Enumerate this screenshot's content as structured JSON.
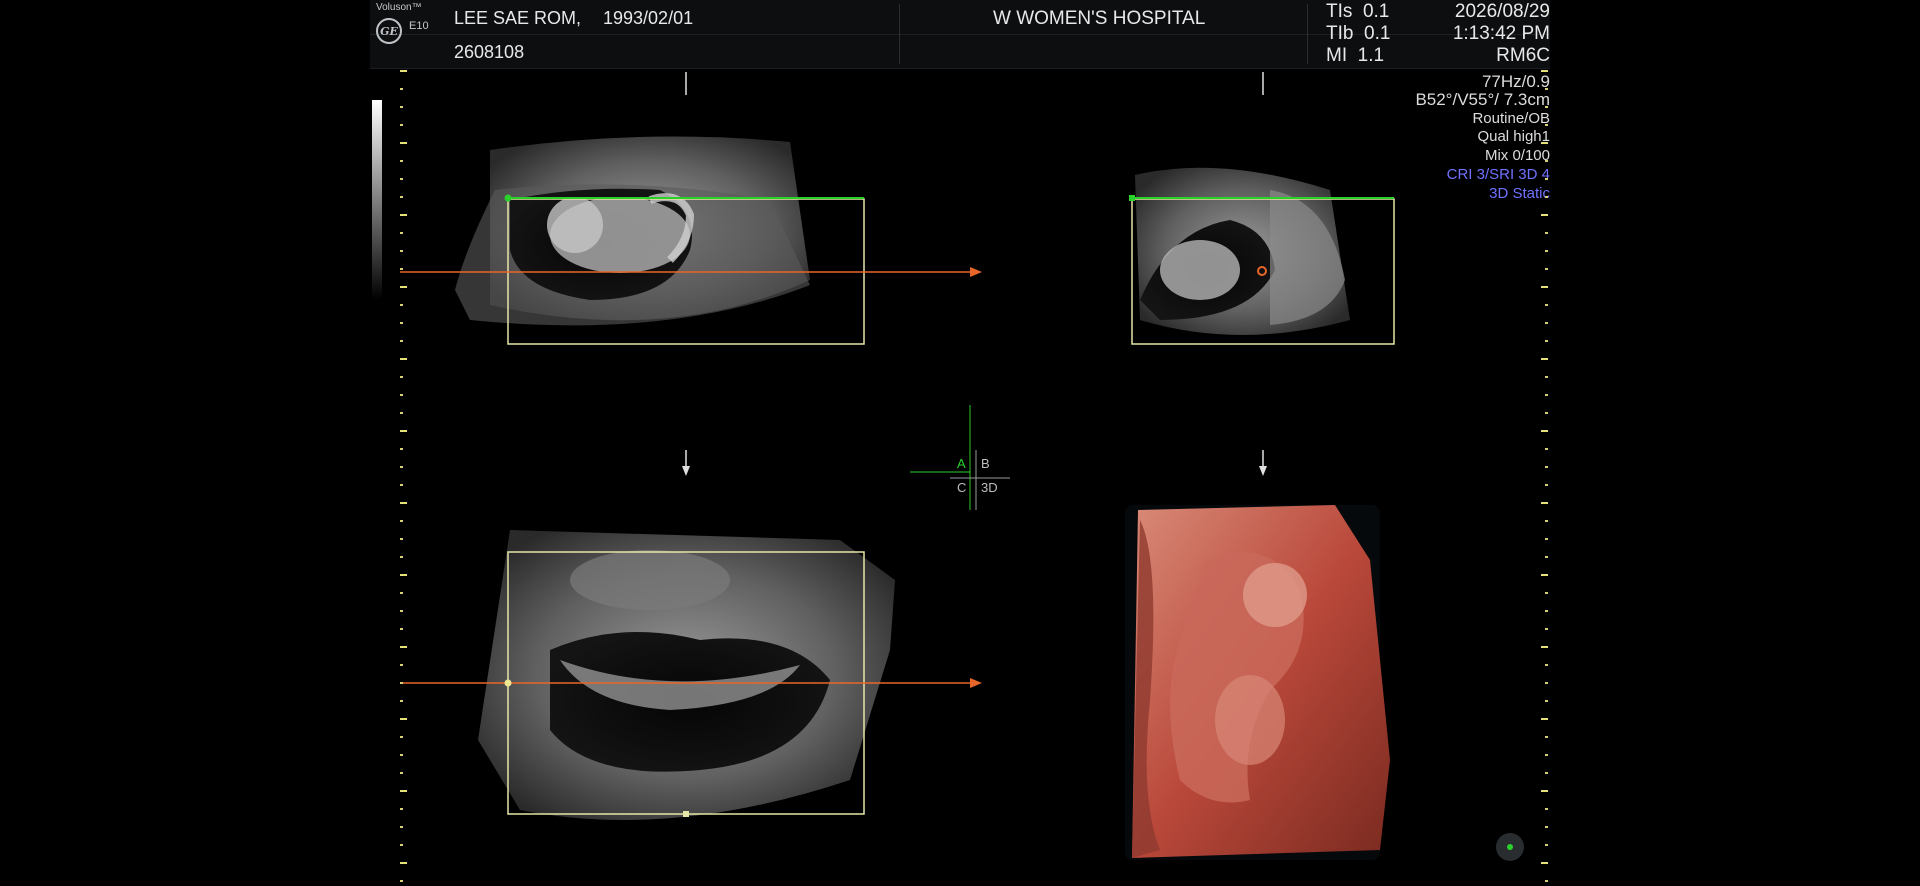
{
  "header": {
    "brand": "Voluson™",
    "model": "E10",
    "logo": "GE",
    "patient_name": "LEE SAE ROM,",
    "patient_dob": "1993/02/01",
    "patient_id": "2608108",
    "hospital": "W WOMEN'S HOSPITAL",
    "indices": [
      {
        "label": "TIs",
        "value": "0.1"
      },
      {
        "label": "TIb",
        "value": "0.1"
      },
      {
        "label": "MI",
        "value": "1.1"
      }
    ],
    "date": "2026/08/29",
    "time": "1:13:42 PM",
    "probe": "RM6C"
  },
  "params": {
    "frame_rate": "77Hz/0.9",
    "geometry": "B52°/V55°/ 7.3cm",
    "preset": "Routine/OB",
    "quality": "Qual high1",
    "mix": "Mix 0/100",
    "cri": "CRI 3/SRI 3D 4",
    "mode": "3D Static"
  },
  "quad_labels": {
    "a": "A",
    "b": "B",
    "c": "C",
    "d": "3D"
  },
  "colors": {
    "background": "#000000",
    "header": "#0c0e10",
    "roi_box": "#e6e6a8",
    "green_line": "#2bd12b",
    "orange_line": "#e8662a",
    "scale": "#e6e07a",
    "render_tissue": "#b9483a",
    "param_blue": "#6f72ff"
  }
}
